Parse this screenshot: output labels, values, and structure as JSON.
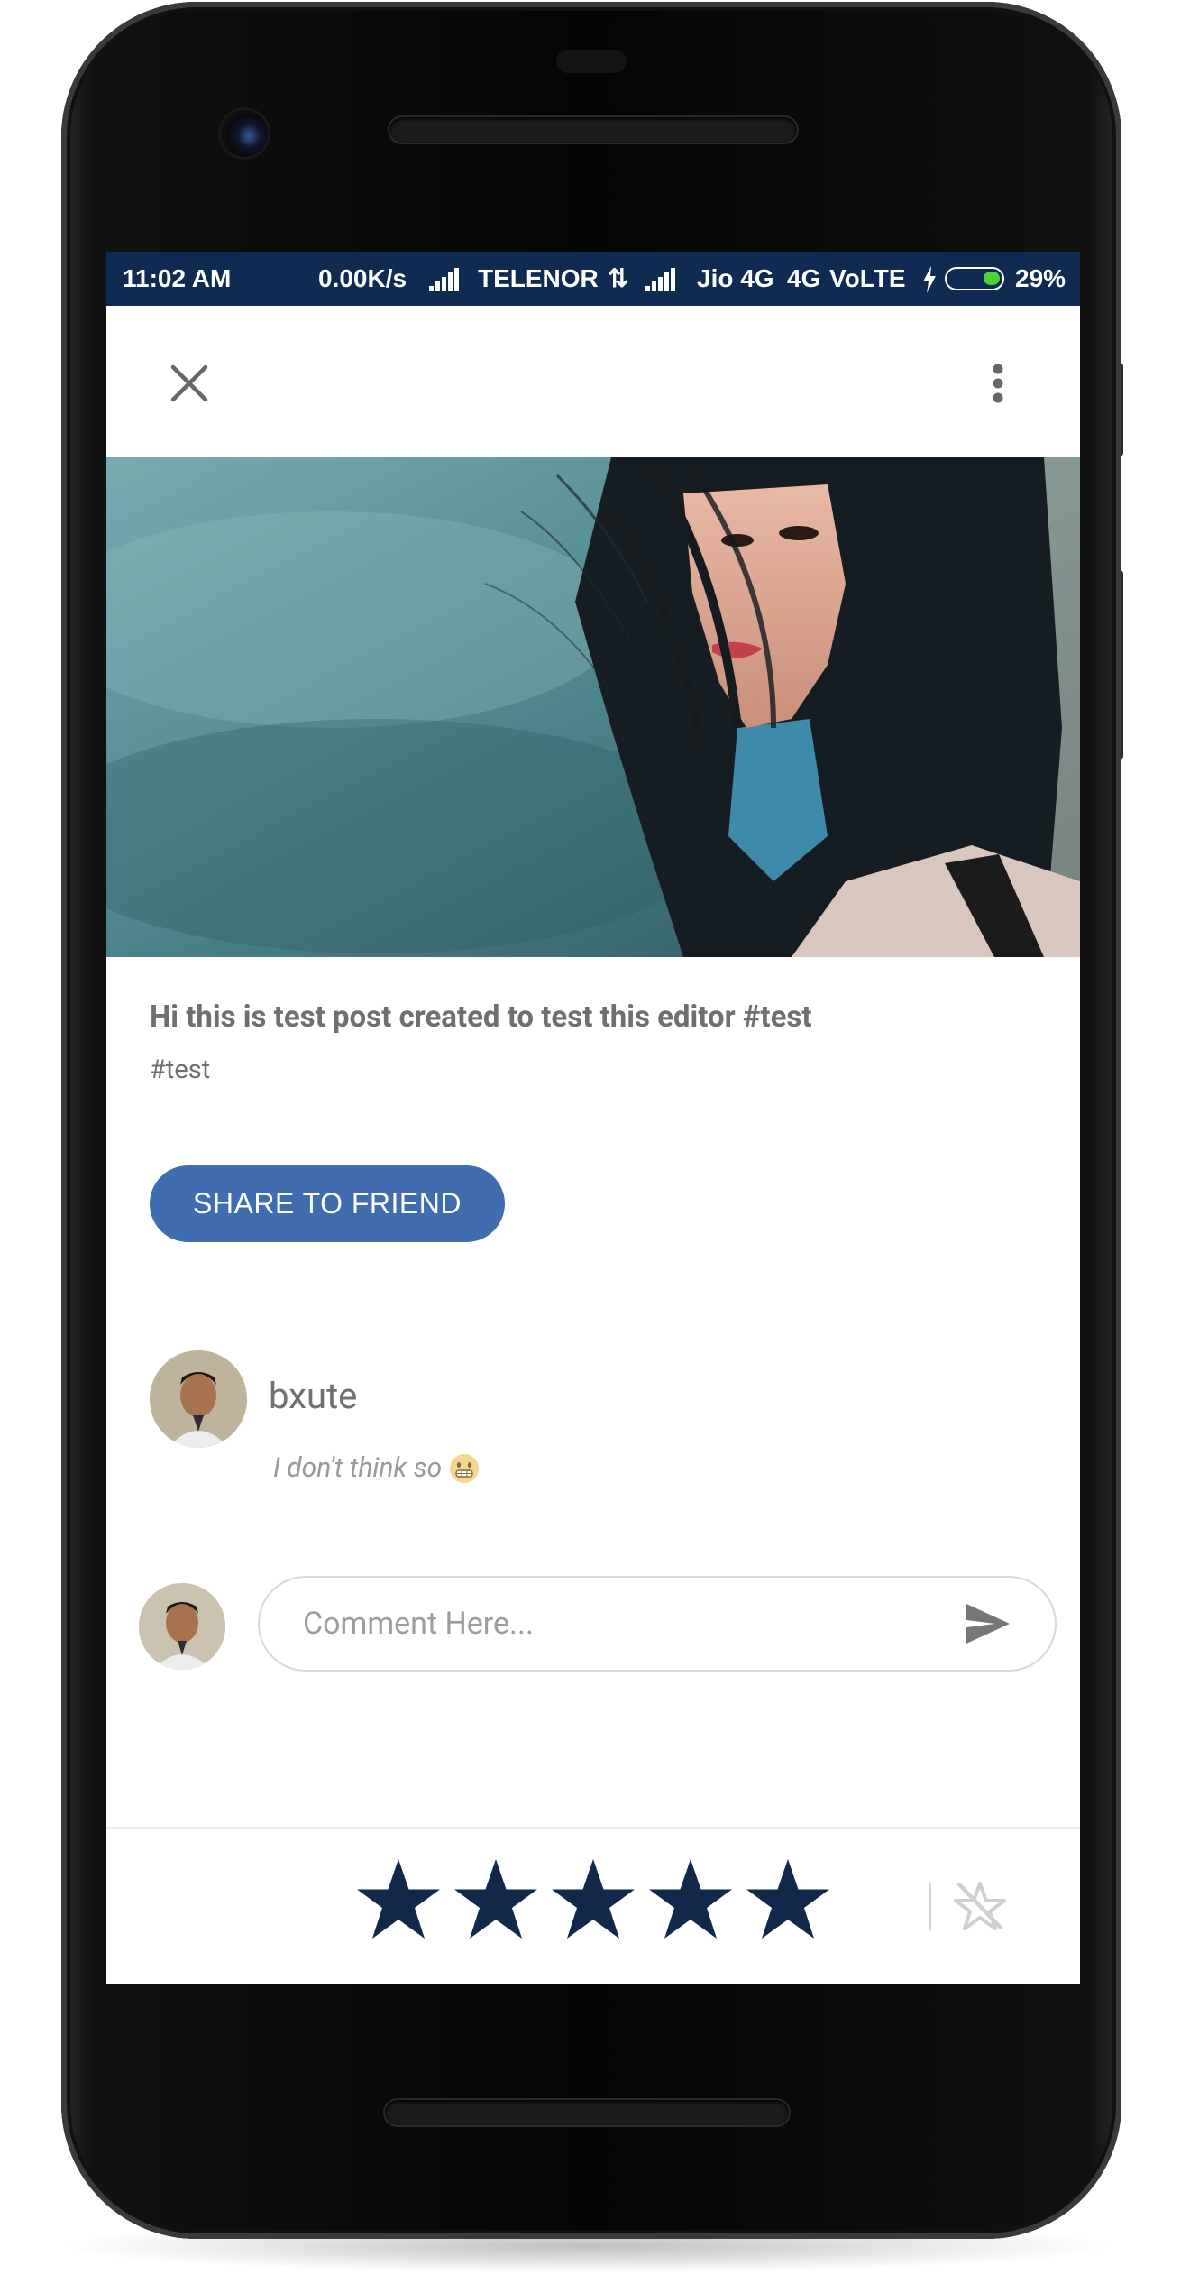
{
  "status_bar": {
    "time": "11:02 AM",
    "net_speed": "0.00K/s",
    "carrier_1": "TELENOR",
    "carrier_2": "Jio 4G",
    "network_type": "4G",
    "volte": "VoLTE",
    "battery": "29%"
  },
  "toolbar": {
    "close_icon": "close-icon",
    "more_icon": "more-vertical-icon"
  },
  "post": {
    "text": "Hi this is test post created to test this editor #test",
    "tag": "#test",
    "share_label": "SHARE TO FRIEND"
  },
  "comment": {
    "user": "bxute",
    "text": "I don't think so",
    "emoji": "grinning-emoji"
  },
  "composer": {
    "placeholder": "Comment Here...",
    "send_icon": "send-icon"
  },
  "rating": {
    "value": 5,
    "max": 5,
    "clear_icon": "star-off-icon"
  },
  "colors": {
    "status_bar": "#0f2b52",
    "accent": "#3f6db0",
    "star": "#12284a"
  }
}
